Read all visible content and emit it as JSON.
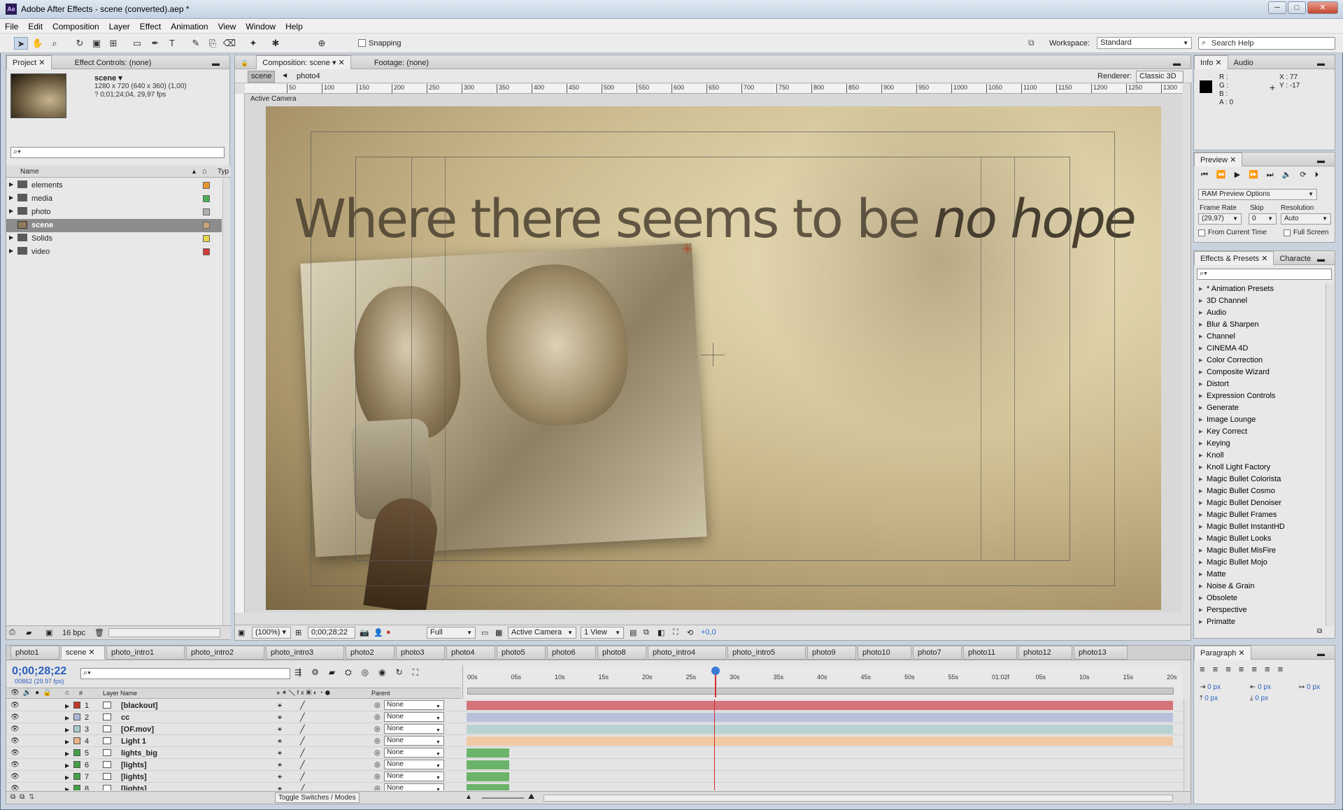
{
  "app": {
    "title": "Adobe After Effects - scene (converted).aep *",
    "icon": "Ae"
  },
  "window_controls": [
    "─",
    "□",
    "✕"
  ],
  "menu": [
    "File",
    "Edit",
    "Composition",
    "Layer",
    "Effect",
    "Animation",
    "View",
    "Window",
    "Help"
  ],
  "toolbar": {
    "snapping": "Snapping",
    "workspace_label": "Workspace:",
    "workspace_value": "Standard",
    "search_help": "Search Help"
  },
  "project": {
    "tab_project": "Project",
    "tab_effect_controls": "Effect Controls: (none)",
    "comp_name": "scene ▾",
    "comp_dims": "1280 x 720  (640 x 360) (1,00)",
    "comp_duration": "? 0;01;24;04, 29,97 fps",
    "col_name": "Name",
    "col_type": "Typ",
    "items": [
      {
        "name": "elements",
        "color": "#e8962e",
        "type": "folder"
      },
      {
        "name": "media",
        "color": "#4caf50",
        "type": "folder"
      },
      {
        "name": "photo",
        "color": "#b0b0b0",
        "type": "folder"
      },
      {
        "name": "scene",
        "color": "#c9a57a",
        "type": "comp",
        "selected": true
      },
      {
        "name": "Solids",
        "color": "#e6d54a",
        "type": "folder"
      },
      {
        "name": "video",
        "color": "#d23a3a",
        "type": "folder"
      }
    ],
    "bpc": "16 bpc"
  },
  "composition": {
    "tab": "Composition: scene",
    "footage_tab": "Footage: (none)",
    "breadcrumb_active": "scene",
    "breadcrumb_next": "photo4",
    "renderer_label": "Renderer:",
    "renderer_value": "Classic 3D",
    "camera_label": "Active Camera",
    "ruler_ticks": [
      "50",
      "100",
      "150",
      "200",
      "250",
      "300",
      "350",
      "400",
      "450",
      "500",
      "550",
      "600",
      "650",
      "700",
      "750",
      "800",
      "850",
      "900",
      "950",
      "1000",
      "1050",
      "1100",
      "1150",
      "1200",
      "1250",
      "1300"
    ],
    "overlay_text_regular": "Where there seems to be ",
    "overlay_text_italic": "no hope",
    "footer": {
      "zoom": "(100%)",
      "timecode": "0;00;28;22",
      "resolution": "Full",
      "view": "Active Camera",
      "views": "1 View",
      "exposure": "+0,0"
    }
  },
  "info": {
    "tab_info": "Info",
    "tab_audio": "Audio",
    "r": "R :",
    "g": "G :",
    "b": "B :",
    "a": "A : 0",
    "x": "X : 77",
    "y": "Y : -17"
  },
  "preview": {
    "tab": "Preview",
    "ram_options": "RAM Preview Options",
    "frame_rate_label": "Frame Rate",
    "frame_rate": "(29,97)",
    "skip_label": "Skip",
    "skip": "0",
    "resolution_label": "Resolution",
    "resolution": "Auto",
    "from_current": "From Current Time",
    "full_screen": "Full Screen"
  },
  "effects": {
    "tab": "Effects & Presets",
    "tab2": "Characte",
    "items": [
      "* Animation Presets",
      "3D Channel",
      "Audio",
      "Blur & Sharpen",
      "Channel",
      "CINEMA 4D",
      "Color Correction",
      "Composite Wizard",
      "Distort",
      "Expression Controls",
      "Generate",
      "Image Lounge",
      "Key Correct",
      "Keying",
      "Knoll",
      "Knoll Light Factory",
      "Magic Bullet Colorista",
      "Magic Bullet Cosmo",
      "Magic Bullet Denoiser",
      "Magic Bullet Frames",
      "Magic Bullet InstantHD",
      "Magic Bullet Looks",
      "Magic Bullet MisFire",
      "Magic Bullet Mojo",
      "Matte",
      "Noise & Grain",
      "Obsolete",
      "Perspective",
      "Primatte"
    ]
  },
  "paragraph": {
    "tab": "Paragraph",
    "fields": [
      "0 px",
      "0 px",
      "0 px",
      "0 px",
      "0 px"
    ]
  },
  "timeline": {
    "tabs": [
      "photo1",
      "scene",
      "photo_intro1",
      "photo_intro2",
      "photo_intro3",
      "photo2",
      "photo3",
      "photo4",
      "photo5",
      "photo6",
      "photo8",
      "photo_intro4",
      "photo_intro5",
      "photo9",
      "photo10",
      "photo7",
      "photo11",
      "photo12",
      "photo13"
    ],
    "active_tab": "scene",
    "timecode": "0;00;28;22",
    "frames": "00862 (29.97 fps)",
    "col_layer_name": "Layer Name",
    "col_parent": "Parent",
    "parent_none": "None",
    "time_ticks": [
      "00s",
      "05s",
      "10s",
      "15s",
      "20s",
      "25s",
      "30s",
      "35s",
      "40s",
      "45s",
      "50s",
      "55s",
      "01:02f",
      "05s",
      "10s",
      "15s",
      "20s"
    ],
    "layers": [
      {
        "num": "1",
        "name": "[blackout]",
        "label": "#c0392b",
        "bar": "#d4737a",
        "bar_end": 1.0
      },
      {
        "num": "2",
        "name": "cc",
        "label": "#b0b8d8",
        "bar": "#b9c0dc",
        "bar_end": 1.0
      },
      {
        "num": "3",
        "name": "[OF.mov]",
        "label": "#a9cbd0",
        "bar": "#b8d2d2",
        "bar_end": 1.0
      },
      {
        "num": "4",
        "name": "Light 1",
        "label": "#e8b38a",
        "bar": "#efc9a6",
        "bar_end": 1.0
      },
      {
        "num": "5",
        "name": "lights_big",
        "label": "#43a047",
        "bar": "#6cb46a",
        "bar_end": 0.06
      },
      {
        "num": "6",
        "name": "[lights]",
        "label": "#43a047",
        "bar": "#6cb46a",
        "bar_end": 0.06
      },
      {
        "num": "7",
        "name": "[lights]",
        "label": "#43a047",
        "bar": "#6cb46a",
        "bar_end": 0.06
      },
      {
        "num": "8",
        "name": "[lights]",
        "label": "#43a047",
        "bar": "#6cb46a",
        "bar_end": 0.06
      }
    ],
    "toggle_label": "Toggle Switches / Modes",
    "playhead_fraction": 0.35
  }
}
